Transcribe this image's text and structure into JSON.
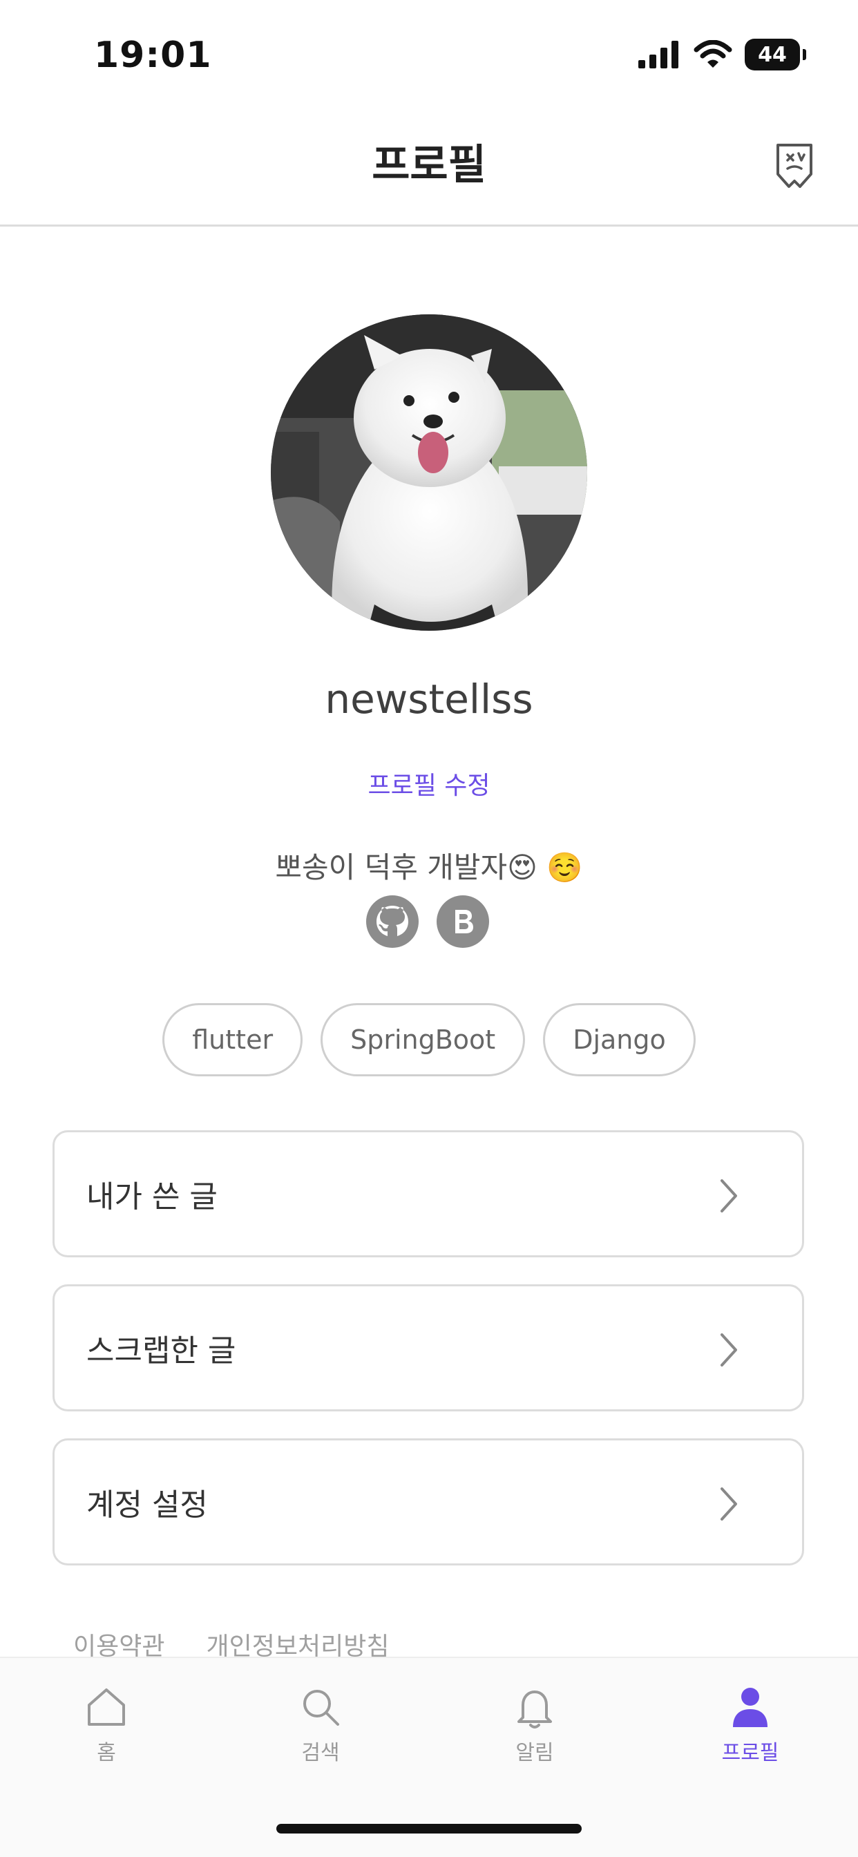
{
  "status_bar": {
    "time": "19:01",
    "battery": "44"
  },
  "header": {
    "title": "프로필",
    "action_icon": "badge-icon"
  },
  "profile": {
    "avatar_icon": "profile-photo",
    "username": "newstellss",
    "edit_label": "프로필 수정",
    "bio": "뽀송이 덕후 개발자😍 ☺️",
    "social": [
      {
        "icon": "github-icon"
      },
      {
        "icon": "blog-icon"
      }
    ],
    "tags": [
      "flutter",
      "SpringBoot",
      "Django"
    ]
  },
  "menu": [
    {
      "label": "내가 쓴 글"
    },
    {
      "label": "스크랩한 글"
    },
    {
      "label": "계정 설정"
    }
  ],
  "footer": {
    "terms": "이용약관",
    "privacy": "개인정보처리방침"
  },
  "tabs": [
    {
      "label": "홈",
      "icon": "home-icon",
      "active": false
    },
    {
      "label": "검색",
      "icon": "search-icon",
      "active": false
    },
    {
      "label": "알림",
      "icon": "bell-icon",
      "active": false
    },
    {
      "label": "프로필",
      "icon": "person-icon",
      "active": true
    }
  ],
  "colors": {
    "accent": "#6b4de6",
    "muted": "#9a9a9a",
    "border": "#dcdcdc"
  }
}
